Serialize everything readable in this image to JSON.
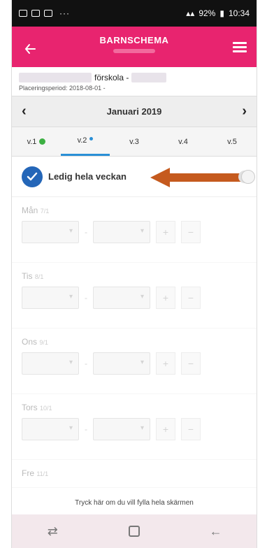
{
  "statusbar": {
    "dots": "···",
    "battery": "92%",
    "time": "10:34"
  },
  "header": {
    "title": "BARNSCHEMA"
  },
  "school": {
    "name_suffix": "förskola -",
    "period": "Placeringsperiod: 2018-08-01 -"
  },
  "monthnav": {
    "month": "Januari 2019",
    "prev": "‹",
    "next": "›"
  },
  "weeks": [
    {
      "label": "v.1"
    },
    {
      "label": "v.2"
    },
    {
      "label": "v.3"
    },
    {
      "label": "v.4"
    },
    {
      "label": "v.5"
    }
  ],
  "ledig": {
    "label": "Ledig hela veckan"
  },
  "days": [
    {
      "name": "Mån",
      "date": "7/1"
    },
    {
      "name": "Tis",
      "date": "8/1"
    },
    {
      "name": "Ons",
      "date": "9/1"
    },
    {
      "name": "Tors",
      "date": "10/1"
    },
    {
      "name": "Fre",
      "date": "11/1"
    }
  ],
  "controls": {
    "dash": "-",
    "plus": "+",
    "minus": "−"
  },
  "hint": "Tryck här om du vill fylla hela skärmen",
  "icons": {
    "back": "back-arrow-icon",
    "menu": "hamburger-menu-icon",
    "check": "check-icon",
    "nav_recent": "recent-apps-icon",
    "nav_home": "home-icon",
    "nav_back": "back-icon"
  },
  "colors": {
    "header": "#e8246f",
    "accent_blue": "#2466b8",
    "annotation_arrow": "#c55a1e",
    "week_done": "#3cb043"
  }
}
